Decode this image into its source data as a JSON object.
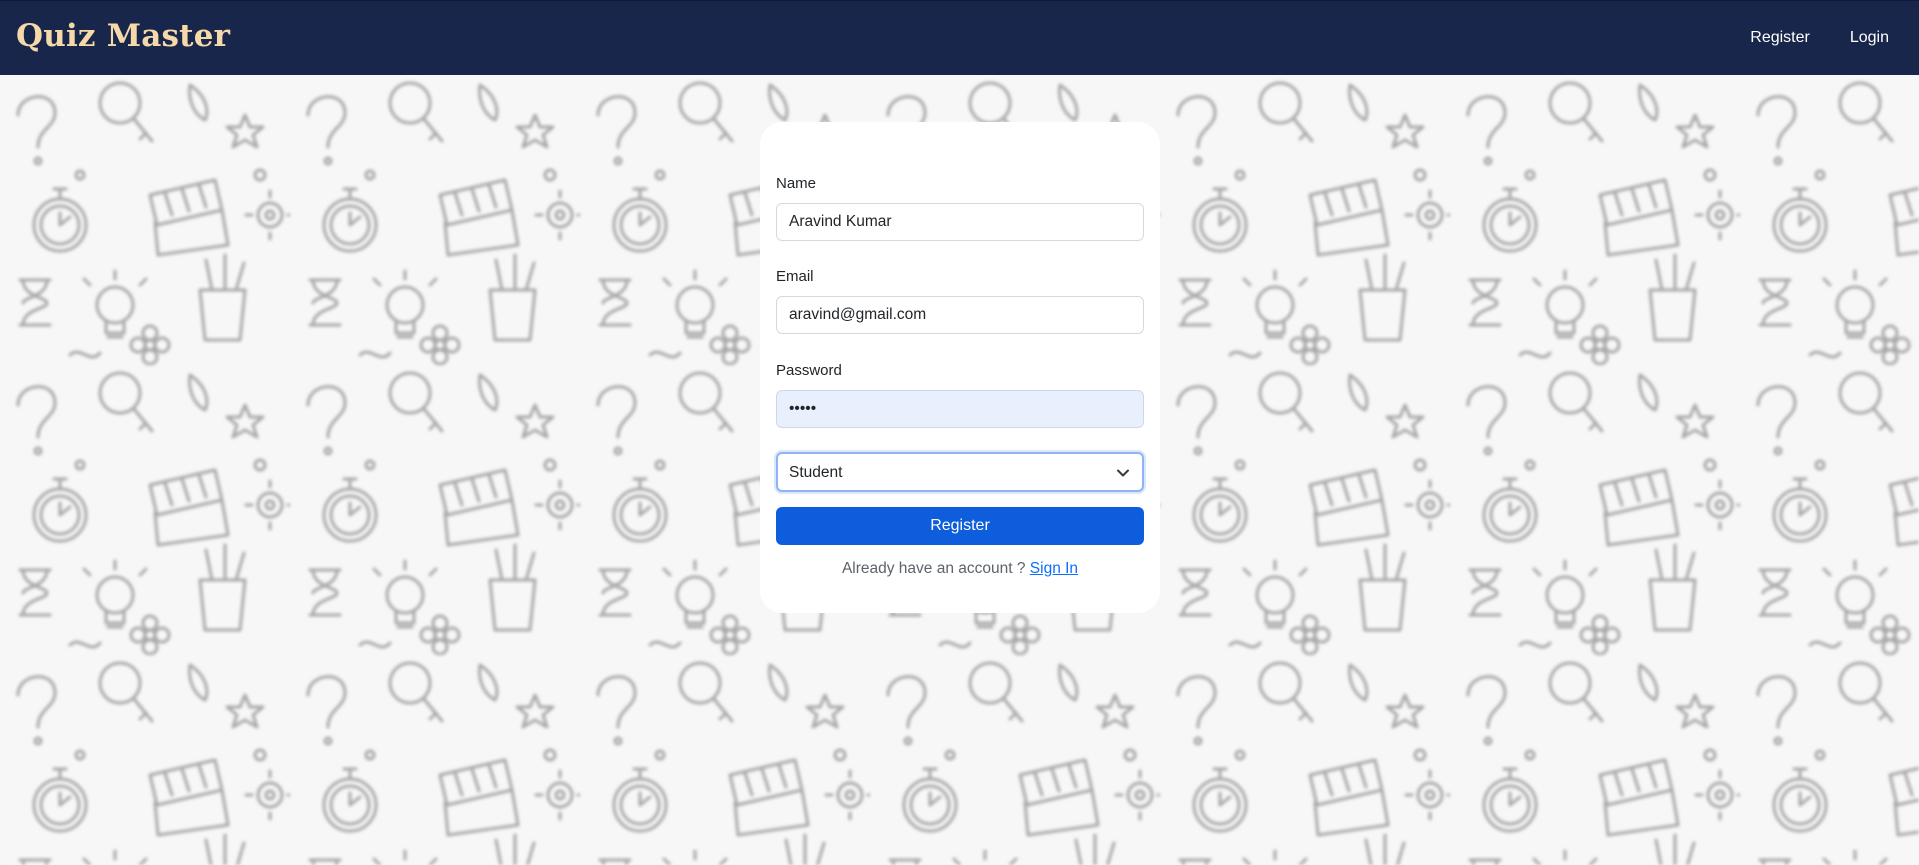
{
  "app": {
    "brand": "Quiz Master"
  },
  "nav": {
    "register": "Register",
    "login": "Login"
  },
  "form": {
    "name_label": "Name",
    "name_value": "Aravind Kumar",
    "email_label": "Email",
    "email_value": "aravind@gmail.com",
    "password_label": "Password",
    "password_value": "•••••",
    "role_selected": "Student",
    "submit_label": "Register",
    "account_prompt": "Already have an account ?",
    "signin_link": "Sign In"
  },
  "colors": {
    "navbar": "#17264a",
    "brand": "#f6d9a8",
    "primary_button": "#0d5ddc",
    "link": "#0d6efd",
    "autofill": "#e8f0fe"
  },
  "icons": {
    "select": "chevron-down-icon",
    "background_pattern": [
      "question-mark",
      "magnifier",
      "stopwatch",
      "hourglass",
      "clapperboard",
      "lightbulb",
      "pencil-cup",
      "gear",
      "star"
    ]
  }
}
